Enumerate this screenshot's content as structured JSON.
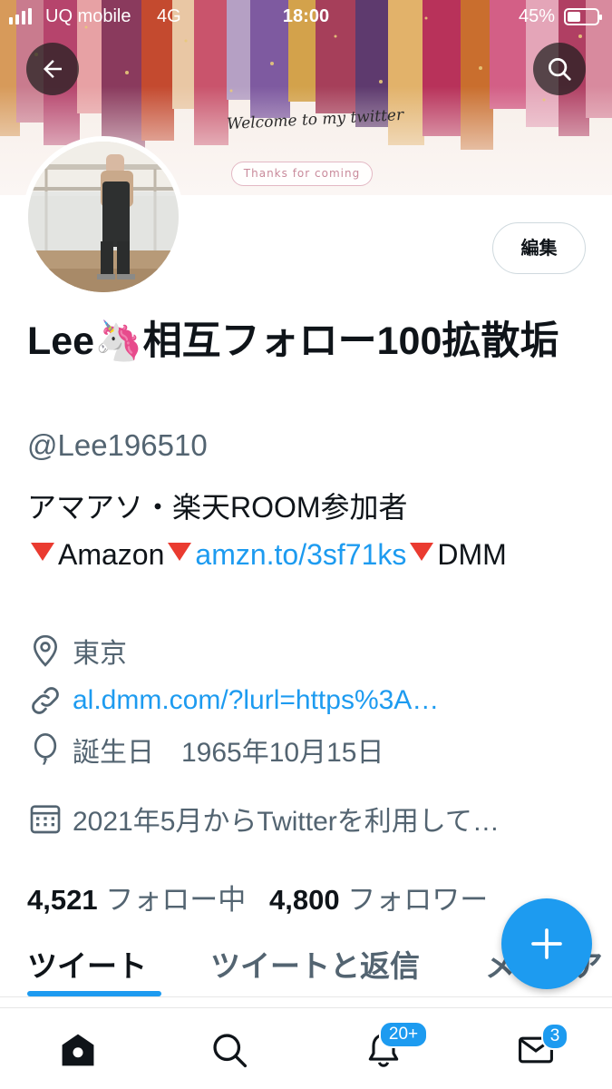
{
  "status_bar": {
    "carrier": "UQ mobile",
    "network": "4G",
    "time": "18:00",
    "battery_percent_label": "45%",
    "battery_level": 0.45,
    "signal_bars": 4
  },
  "header": {
    "back_icon": "arrow-left-icon",
    "search_icon": "search-icon",
    "banner_text": "Welcome to my twitter",
    "banner_button": "Thanks for coming"
  },
  "profile": {
    "edit_label": "編集",
    "display_name": "Lee🦄相互フォロー100拡散垢",
    "handle": "@Lee196510",
    "bio_line1": "アマアソ・楽天ROOM参加者",
    "bio_amazon": "Amazon",
    "bio_link": "amzn.to/3sf71ks",
    "bio_dmm": "DMM",
    "location": "東京",
    "website": "al.dmm.com/?lurl=https%3A…",
    "birthday": "誕生日　1965年10月15日",
    "joined": "2021年5月からTwitterを利用して…",
    "following_count": "4,521",
    "following_label": "フォロー中",
    "followers_count": "4,800",
    "followers_label": "フォロワー"
  },
  "tabs": [
    "ツイート",
    "ツイートと返信",
    "メディア"
  ],
  "fab_icon": "plus-icon",
  "bottom_nav": {
    "items": [
      "home-icon",
      "search-icon",
      "notifications-icon",
      "messages-icon"
    ],
    "notifications_badge": "20+",
    "messages_badge": "3"
  },
  "colors": {
    "accent": "#1d9bf0",
    "text_primary": "#0f1419",
    "text_secondary": "#536471"
  }
}
